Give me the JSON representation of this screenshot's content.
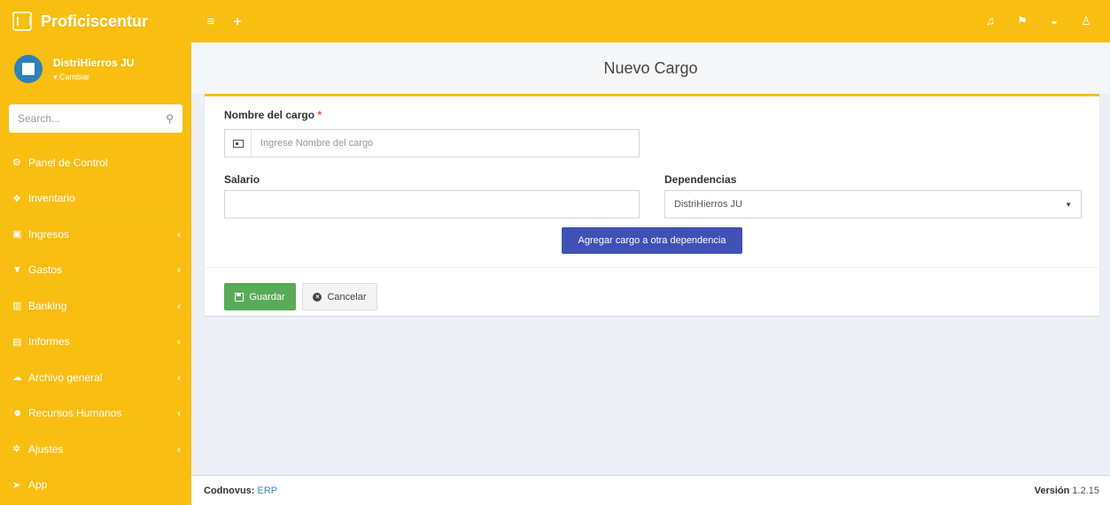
{
  "app": {
    "name": "Proficiscentur"
  },
  "topbar": {
    "left_icons": [
      "menu-icon",
      "plus-icon"
    ],
    "right_icons": [
      "bell-icon",
      "flag-icon",
      "chat-icon",
      "user-icon"
    ]
  },
  "sidebar": {
    "company_name": "DistriHierros JU",
    "company_switch": "▾ Cambiar",
    "search_placeholder": "Search...",
    "items": [
      {
        "label": "Panel de Control",
        "icon": "dashboard-icon",
        "glyph": "⚙",
        "has_children": false
      },
      {
        "label": "Inventario",
        "icon": "cubes-icon",
        "glyph": "❖",
        "has_children": false
      },
      {
        "label": "Ingresos",
        "icon": "money-icon",
        "glyph": "▣",
        "has_children": true
      },
      {
        "label": "Gastos",
        "icon": "cart-icon",
        "glyph": "▼",
        "has_children": true
      },
      {
        "label": "Banking",
        "icon": "bank-icon",
        "glyph": "▥",
        "has_children": true
      },
      {
        "label": "Informes",
        "icon": "bar-chart-icon",
        "glyph": "▤",
        "has_children": true
      },
      {
        "label": "Archivo general",
        "icon": "cloud-icon",
        "glyph": "☁",
        "has_children": true
      },
      {
        "label": "Recursos Humanos",
        "icon": "users-icon",
        "glyph": "☻",
        "has_children": true
      },
      {
        "label": "Ajustes",
        "icon": "cogs-icon",
        "glyph": "✲",
        "has_children": true
      },
      {
        "label": "App",
        "icon": "plane-icon",
        "glyph": "➤",
        "has_children": false
      }
    ]
  },
  "page": {
    "title": "Nuevo Cargo"
  },
  "form": {
    "nombre_label": "Nombre del cargo",
    "required_mark": "*",
    "nombre_placeholder": "Ingrese Nombre del cargo",
    "nombre_value": "",
    "salario_label": "Salario",
    "salario_value": "",
    "dependencias_label": "Dependencias",
    "dependencias_value": "DistriHierros JU",
    "add_button": "Agregar cargo a otra dependencia",
    "save_button": "Guardar",
    "cancel_button": "Cancelar"
  },
  "footer": {
    "brand": "Codnovus:",
    "link": "ERP",
    "version_label": "Versión",
    "version": "1.2.15"
  },
  "colors": {
    "brand_yellow": "#f8be12",
    "primary_blue": "#3f51b5",
    "success_green": "#5aab58"
  }
}
